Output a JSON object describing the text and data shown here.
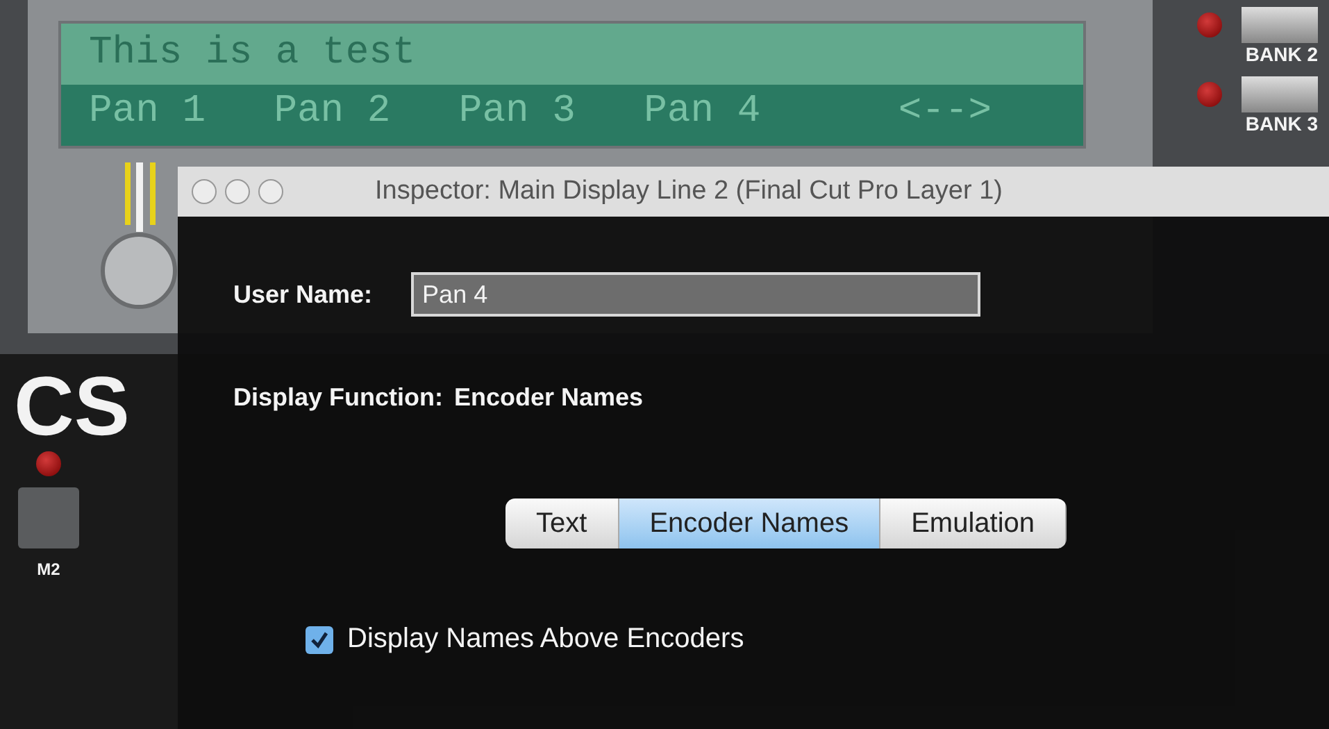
{
  "lcd": {
    "line_1": "This is a test",
    "line_2": [
      "Pan 1",
      "Pan 2",
      "Pan 3",
      "Pan 4",
      "<-->"
    ]
  },
  "bank_buttons": [
    {
      "label": "BANK 2"
    },
    {
      "label": "BANK 3"
    }
  ],
  "model_label": "CS",
  "mode_buttons": [
    {
      "label": "M2"
    }
  ],
  "inspector": {
    "title": "Inspector: Main Display Line 2 (Final Cut Pro Layer 1)",
    "user_name": {
      "label": "User Name:",
      "value": "Pan 4"
    },
    "display_function": {
      "label": "Display Function:",
      "value": "Encoder Names"
    },
    "segments": [
      {
        "label": "Text",
        "selected": false
      },
      {
        "label": "Encoder Names",
        "selected": true
      },
      {
        "label": "Emulation",
        "selected": false
      }
    ],
    "checkbox": {
      "label": "Display Names Above Encoders",
      "checked": true
    }
  }
}
